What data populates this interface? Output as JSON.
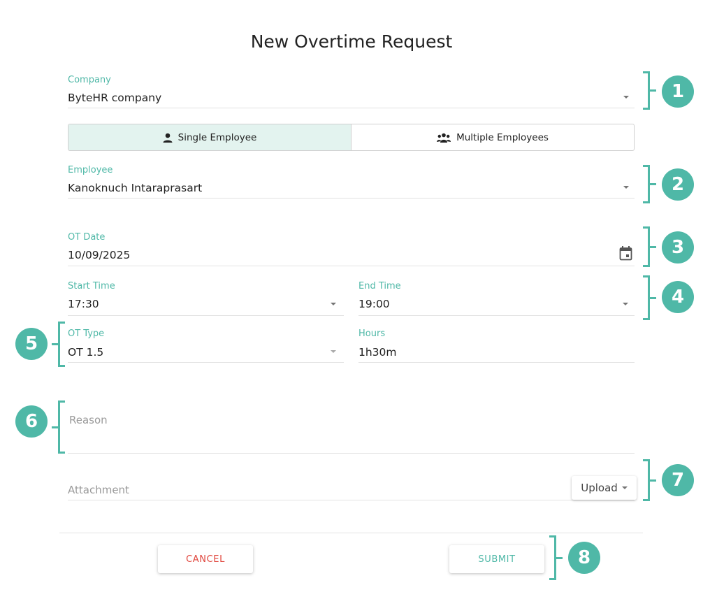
{
  "dialog": {
    "title": "New Overtime Request"
  },
  "company": {
    "label": "Company",
    "value": "ByteHR company"
  },
  "mode_toggle": {
    "single_label": "Single Employee",
    "multiple_label": "Multiple Employees",
    "selected": "single"
  },
  "employee": {
    "label": "Employee",
    "value": "Kanoknuch Intaraprasart"
  },
  "ot_date": {
    "label": "OT Date",
    "value": "10/09/2025"
  },
  "start_time": {
    "label": "Start Time",
    "value": "17:30"
  },
  "end_time": {
    "label": "End Time",
    "value": "19:00"
  },
  "ot_type": {
    "label": "OT Type",
    "value": "OT 1.5"
  },
  "hours": {
    "label": "Hours",
    "value": "1h30m"
  },
  "reason": {
    "placeholder": "Reason",
    "value": ""
  },
  "attachment": {
    "placeholder": "Attachment",
    "upload_label": "Upload"
  },
  "actions": {
    "cancel_label": "CANCEL",
    "submit_label": "SUBMIT"
  },
  "callouts": [
    "1",
    "2",
    "3",
    "4",
    "5",
    "6",
    "7",
    "8"
  ],
  "colors": {
    "accent": "#4fb8a7",
    "danger": "#e0453c",
    "segment_active_bg": "#e3f3ef"
  },
  "icons": {
    "single_employee": "person-icon",
    "multiple_employees": "group-icon",
    "ot_date": "calendar-icon",
    "dropdown": "caret-down-icon"
  }
}
